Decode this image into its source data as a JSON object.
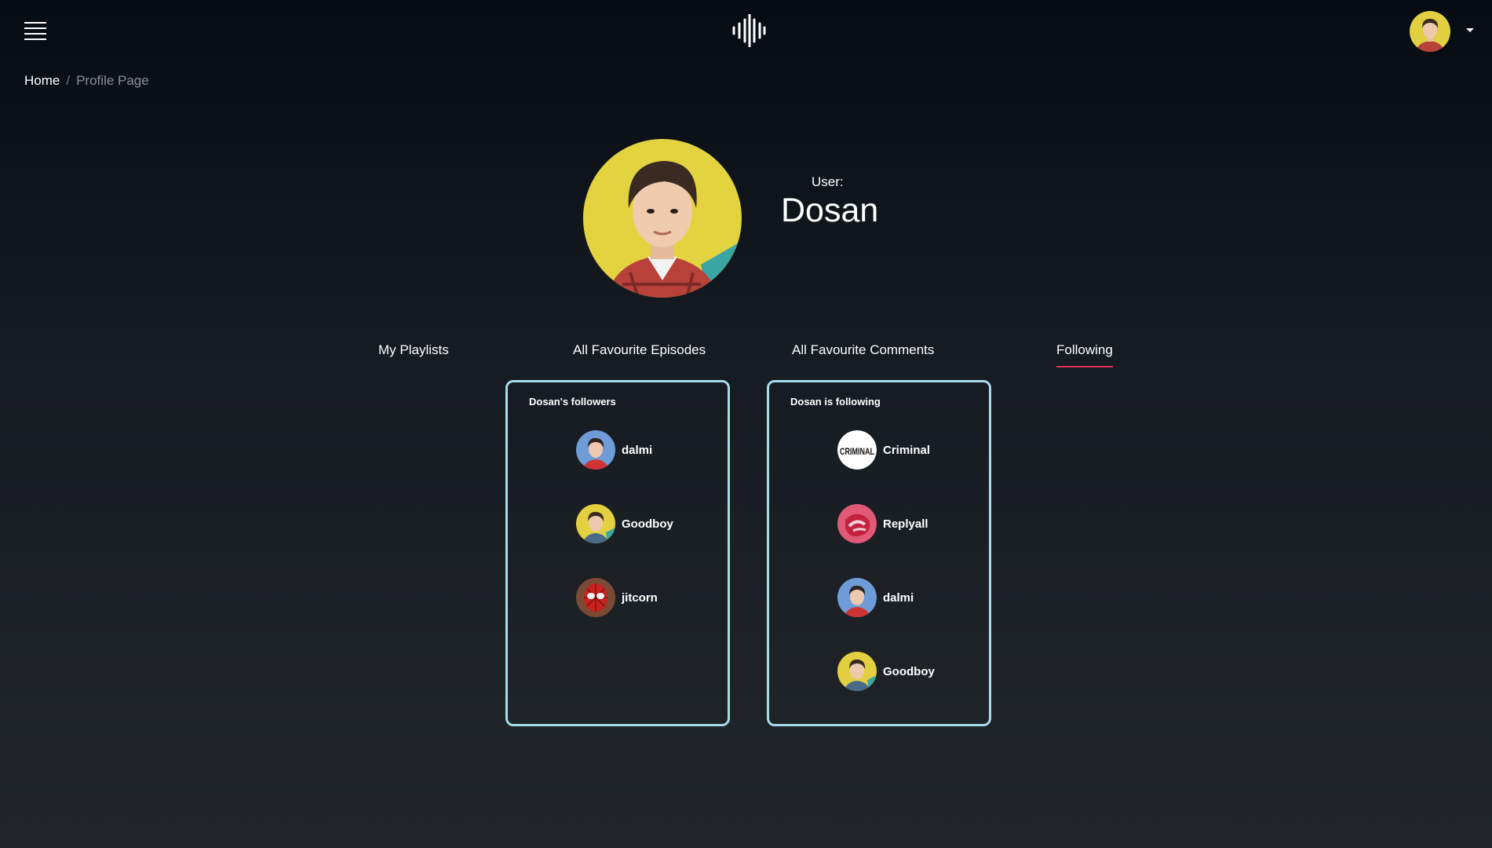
{
  "header": {
    "menu_icon": "hamburger-menu-icon",
    "logo_icon": "sound-wave-logo-icon",
    "avatar_icon": "user-avatar-icon",
    "dropdown_icon": "caret-down-icon"
  },
  "breadcrumb": {
    "home": "Home",
    "separator": "/",
    "current": "Profile Page"
  },
  "profile": {
    "label": "User:",
    "name": "Dosan"
  },
  "tabs": [
    {
      "label": "My Playlists",
      "active": false
    },
    {
      "label": "All Favourite Episodes",
      "active": false
    },
    {
      "label": "All Favourite Comments",
      "active": false
    },
    {
      "label": "Following",
      "active": true
    }
  ],
  "followers": {
    "title": "Dosan's followers",
    "users": [
      {
        "name": "dalmi"
      },
      {
        "name": "Goodboy"
      },
      {
        "name": "jitcorn"
      }
    ]
  },
  "following": {
    "title": "Dosan is following",
    "users": [
      {
        "name": "Criminal",
        "logo_text": "CRIMINAL"
      },
      {
        "name": "Replyall"
      },
      {
        "name": "dalmi"
      },
      {
        "name": "Goodboy"
      }
    ]
  },
  "colors": {
    "accent": "#e0305e",
    "panel_border": "#a6dbe8"
  }
}
